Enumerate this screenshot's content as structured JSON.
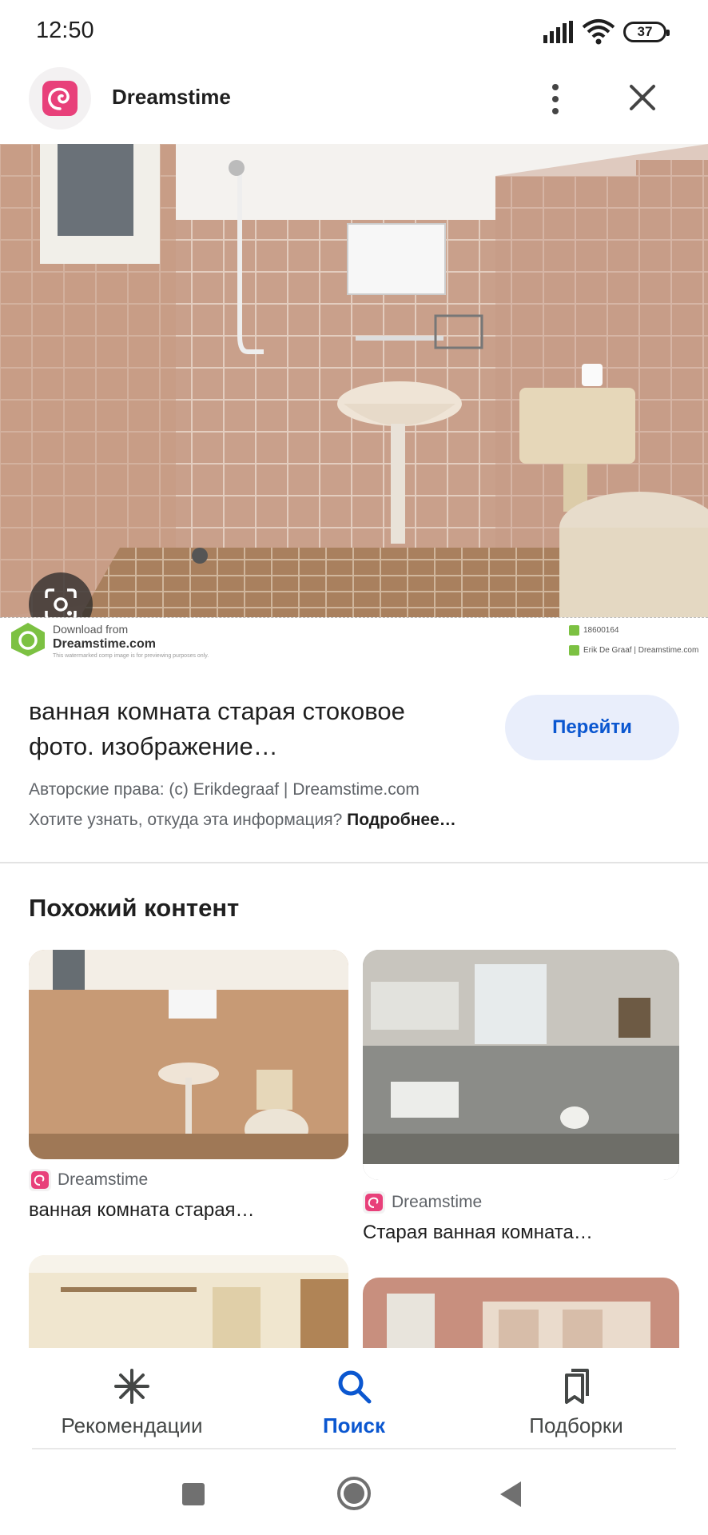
{
  "status_bar": {
    "time": "12:50",
    "battery": "37"
  },
  "header": {
    "site_name": "Dreamstime",
    "icons": [
      "dreamstime-logo",
      "more-vert-icon",
      "close-icon"
    ]
  },
  "main_image": {
    "description_icon": "bathroom-photo",
    "watermark": {
      "download_from": "Download from",
      "site": "Dreamstime.com",
      "note": "This watermarked comp image is for previewing purposes only.",
      "id": "18600164",
      "author": "Erik De Graaf | Dreamstime.com"
    }
  },
  "result": {
    "title": "ванная комната старая стоковое фото. изображение…",
    "go_button": "Перейти",
    "copyright": "Авторские права: (c) Erikdegraaf | Dreamstime.com",
    "info_question": "Хотите узнать, откуда эта информация?",
    "info_more": "Подробнее…"
  },
  "similar": {
    "title": "Похожий контент",
    "items": [
      {
        "source": "Dreamstime",
        "title": "ванная комната старая…"
      },
      {
        "source": "Dreamstime",
        "title": "Старая ванная комната…"
      }
    ]
  },
  "bottom_nav": {
    "items": [
      {
        "label": "Рекомендации",
        "icon": "asterisk-icon",
        "active": false
      },
      {
        "label": "Поиск",
        "icon": "search-icon",
        "active": true
      },
      {
        "label": "Подборки",
        "icon": "collections-icon",
        "active": false
      }
    ]
  },
  "colors": {
    "accent": "#0b57d0",
    "brand": "#e8407a",
    "tile": "#c79a84"
  }
}
